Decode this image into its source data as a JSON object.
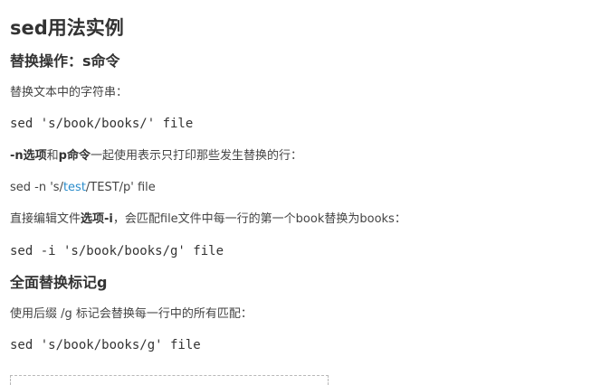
{
  "title": "sed用法实例",
  "sections": {
    "replace": {
      "heading": "替换操作：s命令",
      "intro": "替换文本中的字符串：",
      "code1": "sed 's/book/books/' file",
      "n_option": {
        "b1": "-n选项",
        "t1": "和",
        "b2": "p命令",
        "t2": "一起使用表示只打印那些发生替换的行："
      },
      "cmd2": {
        "pre": "sed -n 's/",
        "link": "test",
        "post": "/TEST/p' file"
      },
      "inplace": {
        "t1": "直接编辑文件",
        "b1": "选项-i",
        "t2": "，会匹配file文件中每一行的第一个book替换为books："
      },
      "code3": "sed -i 's/book/books/g' file"
    },
    "global": {
      "heading": "全面替换标记g",
      "intro": "使用后缀 /g 标记会替换每一行中的所有匹配：",
      "code": "sed 's/book/books/g' file"
    }
  },
  "colors": {
    "text": "#333333",
    "link": "#2a8ccb"
  }
}
